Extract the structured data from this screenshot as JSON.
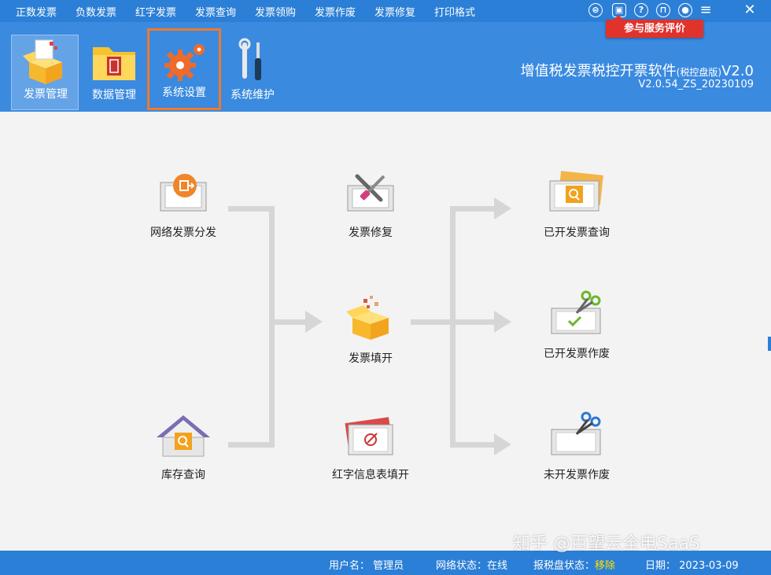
{
  "menu": {
    "items": [
      "正数发票",
      "负数发票",
      "红字发票",
      "发票查询",
      "发票领购",
      "发票作废",
      "发票修复",
      "打印格式"
    ]
  },
  "window_icons": [
    "theme-icon",
    "service-icon",
    "help-icon",
    "lock-icon",
    "user-icon",
    "menu-icon",
    "close-icon"
  ],
  "feedback_label": "参与服务评价",
  "toolbar": {
    "items": [
      {
        "label": "发票管理",
        "icon": "invoice-box-icon",
        "active": true
      },
      {
        "label": "数据管理",
        "icon": "folder-icon",
        "active": false
      },
      {
        "label": "系统设置",
        "icon": "gear-icon",
        "active": false,
        "highlighted": true
      },
      {
        "label": "系统维护",
        "icon": "tools-icon",
        "active": false
      }
    ]
  },
  "brand": {
    "title": "增值税发票税控开票软件",
    "edition": "(税控盘版)",
    "version_tag": "V2.0",
    "build": "V2.0.54_ZS_20230109"
  },
  "workflow": {
    "network_dist": "网络发票分发",
    "inventory": "库存查询",
    "repair": "发票修复",
    "issue": "发票填开",
    "red_form": "红字信息表填开",
    "query_issued": "已开发票查询",
    "void_issued": "已开发票作废",
    "void_unissued": "未开发票作废"
  },
  "status": {
    "user_label": "用户名：",
    "user_value": "管理员",
    "net_label": "网络状态：",
    "net_value": "在线",
    "disk_label": "报税盘状态：",
    "disk_value": "移除",
    "date_label": "日期：",
    "date_value": "2023-03-09"
  },
  "watermark": "知乎 @百望云全电SaaS",
  "colors": {
    "menubar": "#2c7fd6",
    "toolbar": "#3a8ae0",
    "highlight": "#f07a2a",
    "feedback": "#e0332c",
    "status_ok": "#ffe100"
  }
}
